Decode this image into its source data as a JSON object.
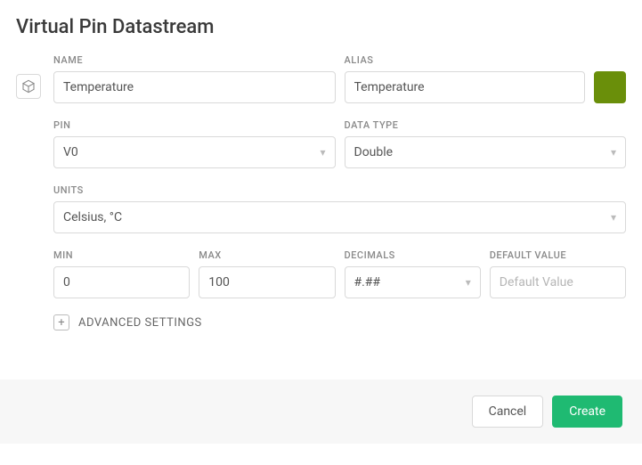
{
  "title": "Virtual Pin Datastream",
  "labels": {
    "name": "NAME",
    "alias": "ALIAS",
    "pin": "PIN",
    "dataType": "DATA TYPE",
    "units": "UNITS",
    "min": "MIN",
    "max": "MAX",
    "decimals": "DECIMALS",
    "defaultValue": "DEFAULT VALUE"
  },
  "values": {
    "name": "Temperature",
    "alias": "Temperature",
    "pin": "V0",
    "dataType": "Double",
    "units": "Celsius, °C",
    "min": "0",
    "max": "100",
    "decimals": "#.##",
    "defaultValue": ""
  },
  "placeholders": {
    "defaultValue": "Default Value"
  },
  "colorSwatch": "#6a8f0a",
  "advanced": "ADVANCED SETTINGS",
  "buttons": {
    "cancel": "Cancel",
    "create": "Create"
  }
}
